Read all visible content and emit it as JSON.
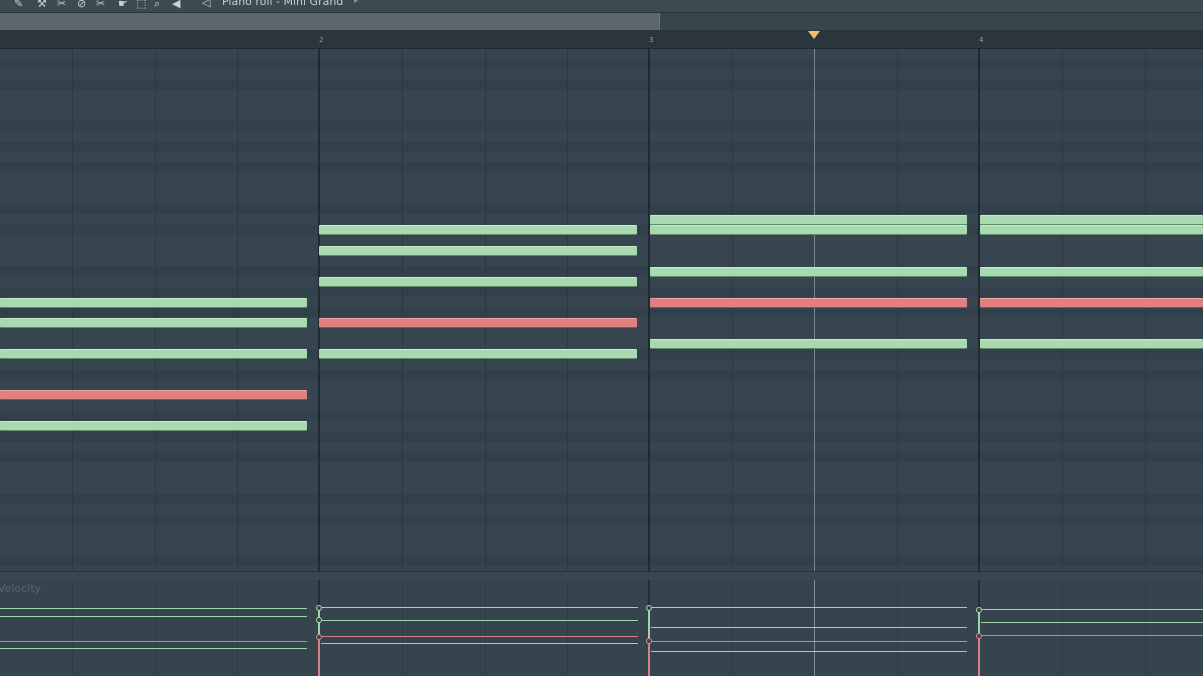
{
  "window": {
    "title": "Piano roll - Mini Grand",
    "title_arrow": "▸",
    "toolbar_icons": [
      {
        "name": "pencil-icon",
        "glyph": "✎"
      },
      {
        "name": "brush-icon",
        "glyph": "⚒"
      },
      {
        "name": "delete-icon",
        "glyph": "✂"
      },
      {
        "name": "mute-icon",
        "glyph": "⊘"
      },
      {
        "name": "slice-icon",
        "glyph": "✂"
      },
      {
        "name": "select-icon",
        "glyph": "⬚"
      },
      {
        "name": "zoom-icon",
        "glyph": "⌕"
      },
      {
        "name": "playback-icon",
        "glyph": "◀"
      }
    ],
    "speaker_glyph": "🔈"
  },
  "ruler": {
    "bars": [
      "2",
      "3",
      "4"
    ]
  },
  "velocity_panel": {
    "label": "Velocity"
  },
  "colors": {
    "note_green": "#a9d9b1",
    "note_red": "#e07f7f",
    "playhead": "#e8c171",
    "background": "#34434e"
  }
}
